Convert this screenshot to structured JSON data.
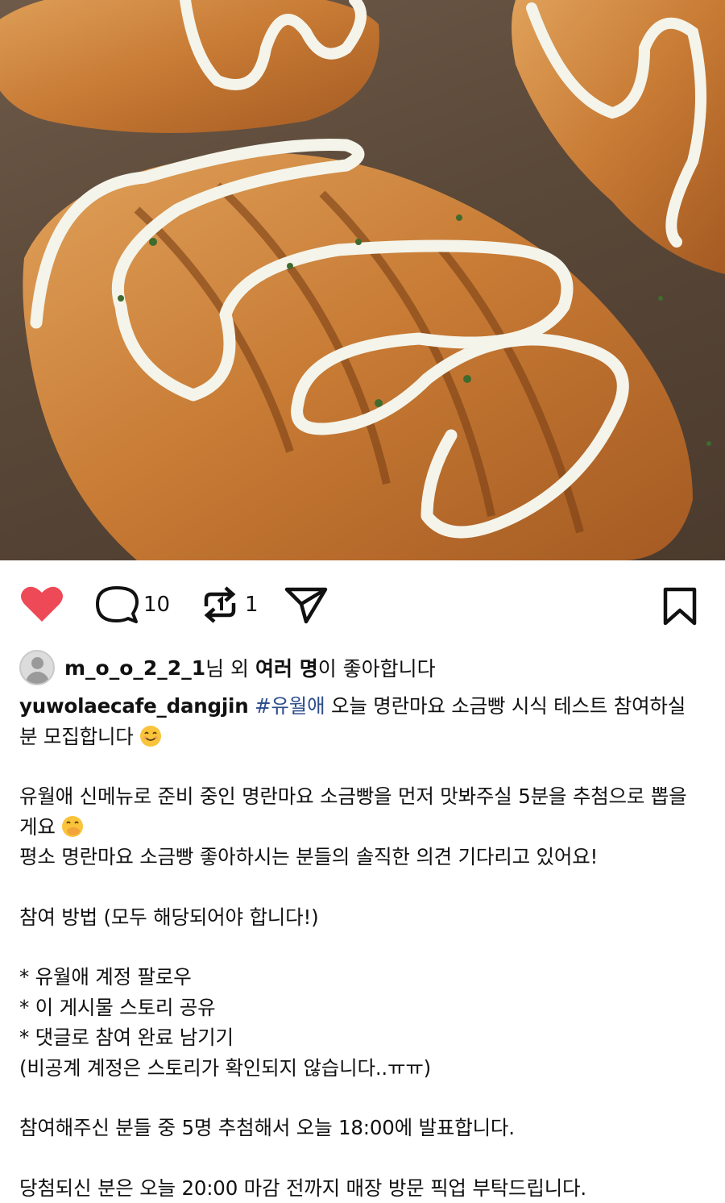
{
  "post": {
    "image_alt": "Salt bread with mayo drizzle",
    "actions": {
      "comment_count": "10",
      "repost_count": "1"
    },
    "likes": {
      "user": "m_o_o_2_2_1",
      "suffix_1": "님 외 ",
      "bold": "여러 명",
      "suffix_2": "이 좋아합니다"
    },
    "caption": {
      "username": "yuwolaecafe_dangjin",
      "hashtag": "#유월애",
      "first_text": " 오늘 명란마요 소금빵 시식 테스트 참여하실 분 모집합니다 ",
      "emoji_1": "smiling-face-emoji",
      "para2_text": "유월애 신메뉴로 준비 중인 명란마요 소금빵을 먼저 맛봐주실 5분을 추첨으로 뽑을게요 ",
      "emoji_2": "hand-over-mouth-emoji",
      "para2_line3": "평소 명란마요 소금빵 좋아하시는 분들의 솔직한 의견 기다리고 있어요!",
      "para3": "참여 방법 (모두 해당되어야 합니다!)",
      "rules": [
        "* 유월애 계정 팔로우",
        "* 이 게시물 스토리 공유",
        "* 댓글로 참여 완료 남기기",
        "(비공계 계정은 스토리가 확인되지 않습니다..ㅠㅠ)"
      ],
      "para5": "참여해주신 분들 중 5명 추첨해서 오늘 18:00에 발표합니다.",
      "para6": "당첨되신 분은 오늘 20:00 마감 전까지 매장 방문 픽업 부탁드립니다."
    },
    "colors": {
      "heart": "#ed4956",
      "hashtag": "#2c4d8c",
      "text": "#111111"
    }
  }
}
